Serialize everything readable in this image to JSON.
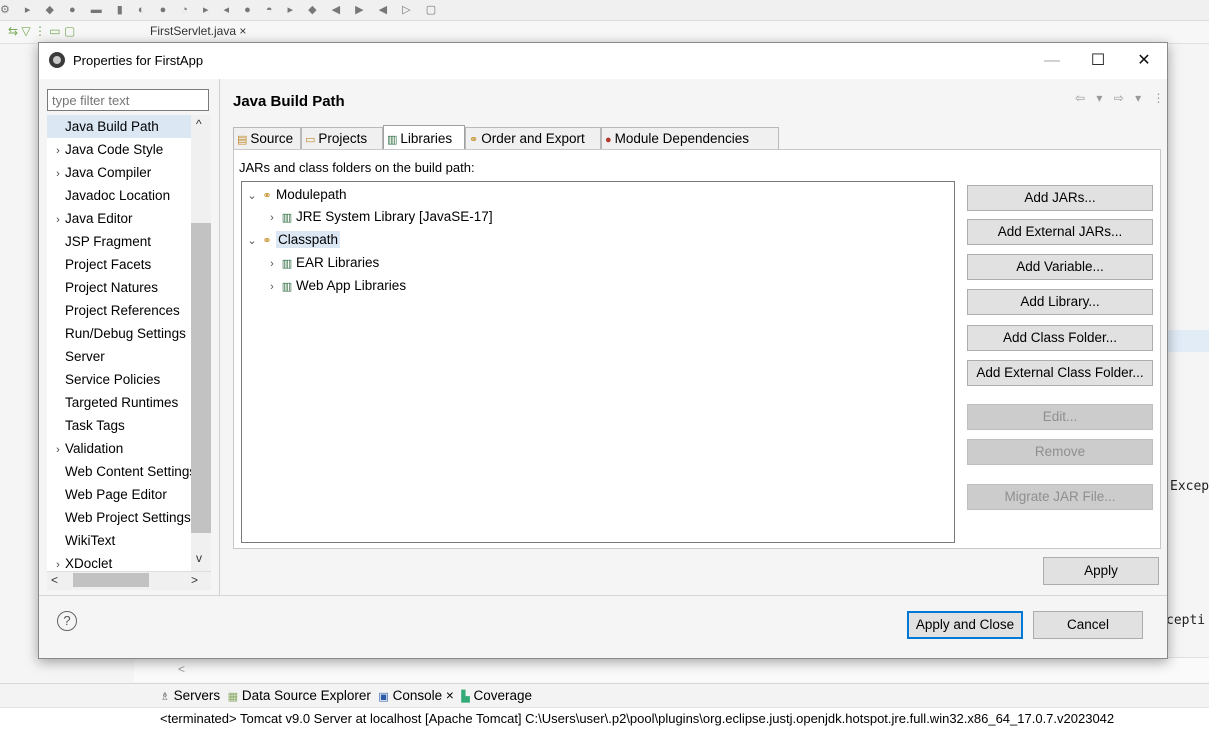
{
  "ide": {
    "editor_tab": "FirstServlet.java ×",
    "right_text_1": "Excep",
    "right_text_2": "cepti",
    "bottom_tabs": [
      {
        "icon": "servers-icon",
        "label": "Servers"
      },
      {
        "icon": "data-source-icon",
        "label": "Data Source Explorer"
      },
      {
        "icon": "console-icon",
        "label": "Console ×"
      },
      {
        "icon": "coverage-icon",
        "label": "Coverage"
      }
    ],
    "console_line": "<terminated> Tomcat v9.0 Server at localhost [Apache Tomcat] C:\\Users\\user\\.p2\\pool\\plugins\\org.eclipse.justj.openjdk.hotspot.jre.full.win32.x86_64_17.0.7.v2023042",
    "scroll_left": "<"
  },
  "dialog": {
    "title": "Properties for FirstApp",
    "window_buttons": {
      "minimize": "—",
      "maximize": "☐",
      "close": "✕"
    },
    "filter_placeholder": "type filter text",
    "nav_items": [
      {
        "label": "Java Build Path",
        "expandable": false,
        "selected": true
      },
      {
        "label": "Java Code Style",
        "expandable": true
      },
      {
        "label": "Java Compiler",
        "expandable": true
      },
      {
        "label": "Javadoc Location",
        "expandable": false
      },
      {
        "label": "Java Editor",
        "expandable": true
      },
      {
        "label": "JSP Fragment",
        "expandable": false
      },
      {
        "label": "Project Facets",
        "expandable": false
      },
      {
        "label": "Project Natures",
        "expandable": false
      },
      {
        "label": "Project References",
        "expandable": false
      },
      {
        "label": "Run/Debug Settings",
        "expandable": false
      },
      {
        "label": "Server",
        "expandable": false
      },
      {
        "label": "Service Policies",
        "expandable": false
      },
      {
        "label": "Targeted Runtimes",
        "expandable": false
      },
      {
        "label": "Task Tags",
        "expandable": false
      },
      {
        "label": "Validation",
        "expandable": true
      },
      {
        "label": "Web Content Settings",
        "expandable": false
      },
      {
        "label": "Web Page Editor",
        "expandable": false
      },
      {
        "label": "Web Project Settings",
        "expandable": false
      },
      {
        "label": "WikiText",
        "expandable": false
      },
      {
        "label": "XDoclet",
        "expandable": true
      }
    ],
    "page_title": "Java Build Path",
    "nav_arrows": "⇦ ▾ ⇨ ▾ ⋮",
    "tabs": [
      {
        "label": "Source",
        "icon": "source-icon",
        "glyph": "▤",
        "active": false
      },
      {
        "label": "Projects",
        "icon": "projects-icon",
        "glyph": "▭",
        "active": false
      },
      {
        "label": "Libraries",
        "icon": "libraries-icon",
        "glyph": "▥",
        "active": true
      },
      {
        "label": "Order and Export",
        "icon": "order-export-icon",
        "glyph": "⚭",
        "active": false
      },
      {
        "label": "Module Dependencies",
        "icon": "module-dependencies-icon",
        "glyph": "●",
        "active": false
      }
    ],
    "section_label": "JARs and class folders on the build path:",
    "tree": [
      {
        "label": "Modulepath",
        "depth": 0,
        "expanded": true,
        "icon": "classpath-icon"
      },
      {
        "label": "JRE System Library [JavaSE-17]",
        "depth": 1,
        "expanded": false,
        "icon": "library-icon"
      },
      {
        "label": "Classpath",
        "depth": 0,
        "expanded": true,
        "icon": "classpath-icon",
        "selected": true
      },
      {
        "label": "EAR Libraries",
        "depth": 1,
        "expanded": false,
        "icon": "library-icon"
      },
      {
        "label": "Web App Libraries",
        "depth": 1,
        "expanded": false,
        "icon": "library-icon"
      }
    ],
    "buttons": [
      {
        "label": "Add JARs...",
        "name": "add-jars-button",
        "enabled": true
      },
      {
        "label": "Add External JARs...",
        "name": "add-external-jars-button",
        "enabled": true
      },
      {
        "label": "Add Variable...",
        "name": "add-variable-button",
        "enabled": true
      },
      {
        "label": "Add Library...",
        "name": "add-library-button",
        "enabled": true
      },
      {
        "label": "Add Class Folder...",
        "name": "add-class-folder-button",
        "enabled": true
      },
      {
        "label": "Add External Class Folder...",
        "name": "add-external-class-folder-button",
        "enabled": true
      },
      {
        "label": "Edit...",
        "name": "edit-button",
        "enabled": false
      },
      {
        "label": "Remove",
        "name": "remove-button",
        "enabled": false
      },
      {
        "label": "Migrate JAR File...",
        "name": "migrate-jar-file-button",
        "enabled": false
      }
    ],
    "apply_label": "Apply",
    "help_label": "?",
    "apply_close_label": "Apply and Close",
    "cancel_label": "Cancel",
    "hscroll_left": "<",
    "hscroll_right": ">",
    "vscroll_up": "^",
    "vscroll_down": "v"
  }
}
